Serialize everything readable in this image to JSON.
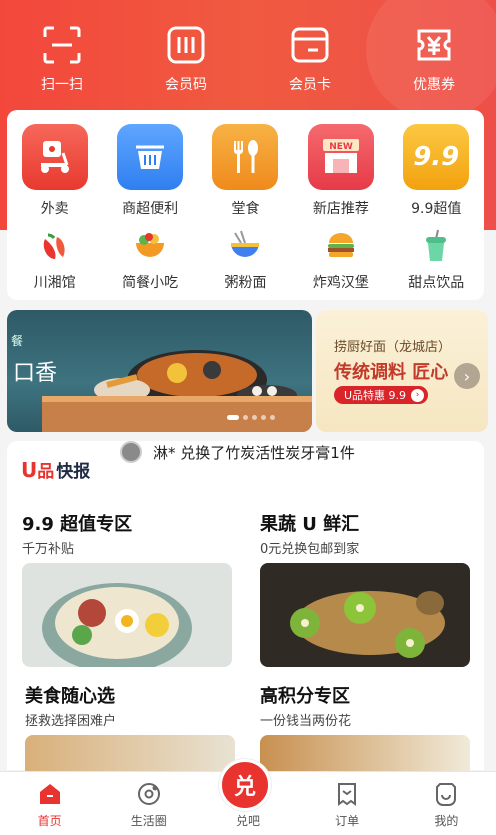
{
  "quick_actions": [
    {
      "label": "扫一扫",
      "icon": "scan-icon"
    },
    {
      "label": "会员码",
      "icon": "member-code-icon"
    },
    {
      "label": "会员卡",
      "icon": "member-card-icon"
    },
    {
      "label": "优惠券",
      "icon": "coupon-icon"
    }
  ],
  "categories_top": [
    {
      "label": "外卖",
      "icon": "scooter-icon",
      "color": "#f0473a"
    },
    {
      "label": "商超便利",
      "icon": "basket-icon",
      "color": "#3f8df2"
    },
    {
      "label": "堂食",
      "icon": "fork-spoon-icon",
      "color": "#f39a25"
    },
    {
      "label": "新店推荐",
      "icon": "new-store-icon",
      "color": "#f0474a",
      "badge": "NEW"
    },
    {
      "label": "9.9超值",
      "icon": "nine-nine-icon",
      "color": "#f5b41f",
      "glyph": "9.9"
    }
  ],
  "categories_bottom": [
    {
      "label": "川湘馆",
      "icon": "chili-icon"
    },
    {
      "label": "简餐小吃",
      "icon": "bowl-food-icon"
    },
    {
      "label": "粥粉面",
      "icon": "noodle-bowl-icon"
    },
    {
      "label": "炸鸡汉堡",
      "icon": "burger-icon"
    },
    {
      "label": "甜点饮品",
      "icon": "drink-icon"
    }
  ],
  "banner_main": {
    "text": "口香",
    "prefix": "餐"
  },
  "banner_side": {
    "line1": "捞厨好面（龙城店）",
    "line2": "传统调料 匠心",
    "pill": "U品特惠 9.9"
  },
  "news": {
    "brand_u": "U",
    "brand_pin": "品",
    "brand_rest": "快报",
    "message": "淋* 兑换了竹炭活性炭牙膏1件"
  },
  "promos": [
    {
      "title": "9.9 超值专区",
      "subtitle": "千万补贴"
    },
    {
      "title": "果蔬 U 鲜汇",
      "subtitle": "0元兑换包邮到家"
    },
    {
      "title": "美食随心选",
      "subtitle": "拯救选择困难户"
    },
    {
      "title": "高积分专区",
      "subtitle": "一份钱当两份花"
    }
  ],
  "tabbar": [
    {
      "label": "首页",
      "icon": "home-icon",
      "active": true
    },
    {
      "label": "生活圈",
      "icon": "life-circle-icon",
      "active": false
    },
    {
      "label": "兑吧",
      "icon": "exchange-icon",
      "active": false,
      "fab_glyph": "兑"
    },
    {
      "label": "订单",
      "icon": "order-icon",
      "active": false
    },
    {
      "label": "我的",
      "icon": "profile-icon",
      "active": false
    }
  ],
  "colors": {
    "brand_red": "#e8332f",
    "hero_red": "#f3473c"
  }
}
